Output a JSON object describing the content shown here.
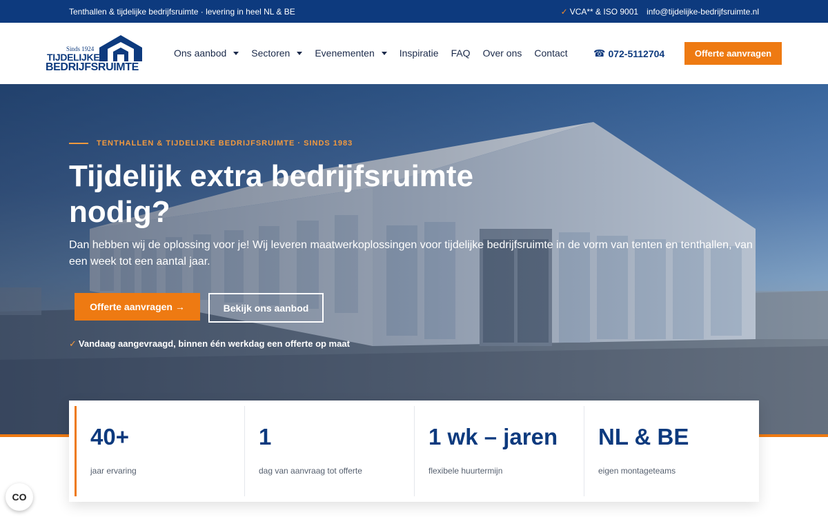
{
  "topbar": {
    "tagline": "Tenthallen & tijdelijke bedrijfsruimte · levering in heel NL & BE",
    "cert": "VCA** & ISO 9001",
    "email": "info@tijdelijke-bedrijfsruimte.nl"
  },
  "logo": {
    "since": "Sinds 1924",
    "line1": "TIJDELIJKE",
    "line2": "BEDRIJFSRUIMTE"
  },
  "nav": {
    "items": [
      {
        "label": "Ons aanbod",
        "dropdown": true
      },
      {
        "label": "Sectoren",
        "dropdown": true
      },
      {
        "label": "Evenementen",
        "dropdown": true
      },
      {
        "label": "Inspiratie",
        "dropdown": false
      },
      {
        "label": "FAQ",
        "dropdown": false
      },
      {
        "label": "Over ons",
        "dropdown": false
      },
      {
        "label": "Contact",
        "dropdown": false
      }
    ],
    "phone": "072-5112704",
    "cta": "Offerte aanvragen"
  },
  "hero": {
    "kicker": "TENTHALLEN & TIJDELIJKE BEDRIJFSRUIMTE · SINDS 1983",
    "title": "Tijdelijk extra bedrijfsruimte nodig?",
    "lead": "Dan hebben wij de oplossing voor je! Wij leveren maatwerkoplossingen voor tijdelijke bedrijfsruimte in de vorm van tenten en tenthallen, van een week tot een aantal jaar.",
    "primary_button": "Offerte aanvragen →",
    "secondary_button": "Bekijk ons aanbod",
    "note": "Vandaag aangevraagd, binnen één werkdag een offerte op maat"
  },
  "stats": [
    {
      "value": "40+",
      "label": "jaar ervaring"
    },
    {
      "value": "1",
      "label": "dag van aanvraag tot offerte"
    },
    {
      "value": "1 wk – jaren",
      "label": "flexibele huurtermijn"
    },
    {
      "value": "NL & BE",
      "label": "eigen montageteams"
    }
  ],
  "cookie_button": "CO",
  "colors": {
    "brand_blue": "#0d3a7e",
    "accent_orange": "#ee7a12"
  }
}
